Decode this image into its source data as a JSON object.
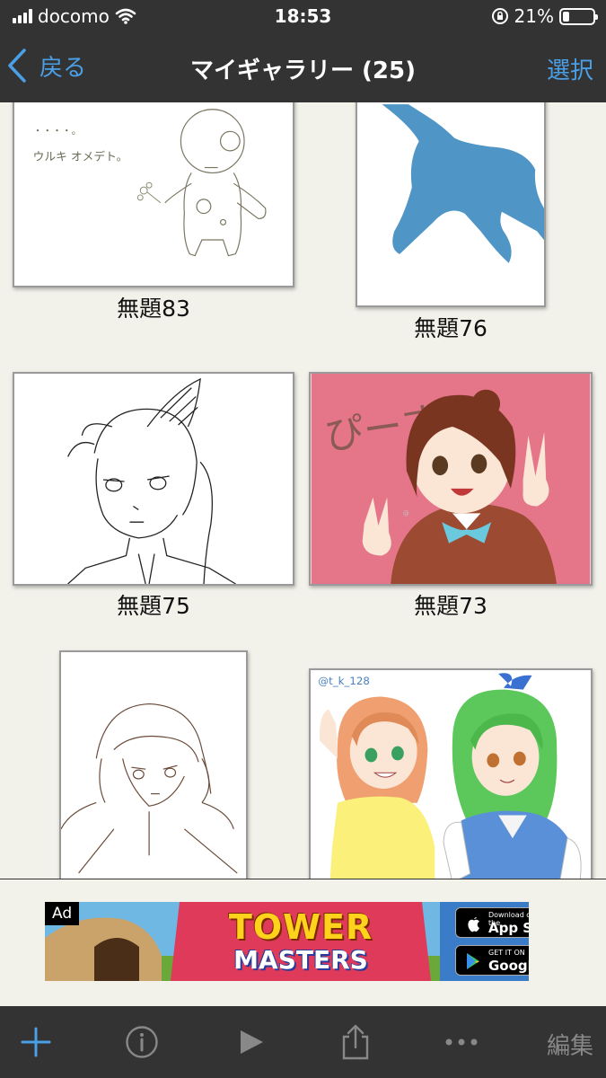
{
  "status": {
    "carrier": "docomo",
    "time": "18:53",
    "battery": "21%",
    "battery_level": 0.21
  },
  "nav": {
    "back_label": "戻る",
    "title": "マイギャラリー (25)",
    "select_label": "選択"
  },
  "gallery": {
    "items": [
      {
        "title": "無題83"
      },
      {
        "title": "無題76"
      },
      {
        "title": "無題75"
      },
      {
        "title": "無題73"
      },
      {
        "title": ""
      },
      {
        "title": ""
      }
    ],
    "art_texts": {
      "doodle_dots": "・・・・。",
      "doodle_text": "ウルキ オメデト。",
      "peace_text": "ぴーす",
      "signature": "@t_k_128"
    }
  },
  "ad": {
    "badge": "Ad",
    "title_line1": "TOWER",
    "title_line2": "MASTERS",
    "appstore_small": "Download on the",
    "appstore_big": "App Store",
    "googleplay_small": "GET IT ON",
    "googleplay_big": "Google Play"
  },
  "toolbar": {
    "edit_label": "編集",
    "icons": [
      "plus-icon",
      "info-icon",
      "play-icon",
      "share-icon",
      "more-icon"
    ]
  },
  "colors": {
    "bar_bg": "#333333",
    "accent": "#4a9fe6",
    "gallery_bg": "#f2f1ea"
  }
}
